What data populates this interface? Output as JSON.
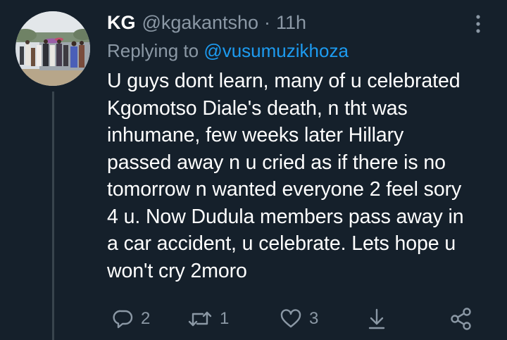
{
  "tweet": {
    "display_name": "KG",
    "handle": "@kgakantsho",
    "separator": "·",
    "time": "11h",
    "reply_prefix": "Replying to",
    "reply_target": "@vusumuzikhoza",
    "text": "U guys dont learn, many of u celebrated\nKgomotso Diale's death, n tht was\ninhumane, few weeks later Hillary\npassed away n u cried as if there is no\ntomorrow n wanted everyone 2 feel sory\n4 u. Now Dudula members pass away in\na car accident, u celebrate. Lets hope u\nwon't cry 2moro"
  },
  "actions": {
    "reply_count": "2",
    "retweet_count": "1",
    "like_count": "3"
  },
  "icons": {
    "more": "more-vertical-icon",
    "reply": "reply-icon",
    "retweet": "retweet-icon",
    "like": "heart-icon",
    "download": "download-icon",
    "share": "share-icon"
  },
  "colors": {
    "background": "#15202b",
    "text_primary": "#ffffff",
    "text_secondary": "#8b98a5",
    "accent": "#1d9bf0",
    "thread_line": "#38444d"
  }
}
